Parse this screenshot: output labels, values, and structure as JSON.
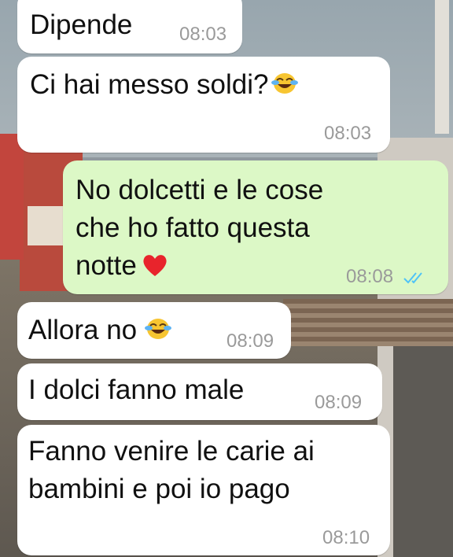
{
  "messages": [
    {
      "id": "m1",
      "direction": "in",
      "text": "Dipende",
      "time": "08:03"
    },
    {
      "id": "m2",
      "direction": "in",
      "text": "Ci hai messo soldi?",
      "emoji": "face-with-tears-of-joy",
      "time": "08:03"
    },
    {
      "id": "m3",
      "direction": "out",
      "lines": [
        "No dolcetti e le cose",
        "che ho fatto questa",
        "notte"
      ],
      "emoji": "red-heart",
      "time": "08:08",
      "status": "read"
    },
    {
      "id": "m4",
      "direction": "in",
      "text": "Allora no",
      "emoji": "face-with-tears-of-joy",
      "time": "08:09"
    },
    {
      "id": "m5",
      "direction": "in",
      "text": "I dolci fanno male",
      "time": "08:09"
    },
    {
      "id": "m6",
      "direction": "in",
      "lines": [
        "Fanno venire le carie ai",
        "bambini e poi io pago"
      ],
      "time": "08:10"
    }
  ],
  "colors": {
    "incoming_bubble": "#ffffff",
    "outgoing_bubble": "#dcf8c6",
    "read_ticks": "#4fc3f7",
    "timestamp": "#9a9a9a"
  },
  "icons": {
    "laugh_emoji": "face-with-tears-of-joy",
    "heart_emoji": "red-heart",
    "read_receipt": "double-check-icon"
  }
}
